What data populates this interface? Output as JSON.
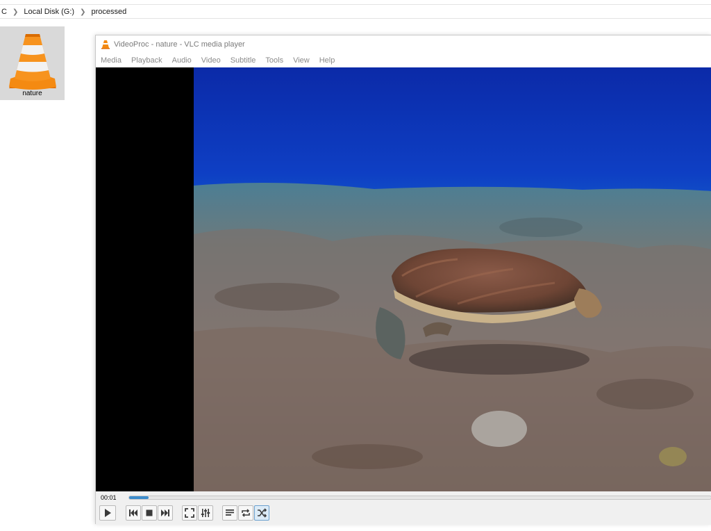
{
  "explorer": {
    "breadcrumb": [
      "C",
      "Local Disk (G:)",
      "processed"
    ]
  },
  "desktop": {
    "icon_label": "nature",
    "icon": "vlc-cone-icon"
  },
  "vlc": {
    "title": "VideoProc - nature - VLC media player",
    "menu": [
      "Media",
      "Playback",
      "Audio",
      "Video",
      "Subtitle",
      "Tools",
      "View",
      "Help"
    ],
    "time_elapsed": "00:01",
    "progress_fraction": 0.034,
    "buttons": [
      {
        "name": "play-button",
        "icon": "play-icon"
      },
      {
        "name": "previous-button",
        "icon": "previous-icon"
      },
      {
        "name": "stop-button",
        "icon": "stop-icon"
      },
      {
        "name": "next-button",
        "icon": "next-icon"
      },
      {
        "name": "fullscreen-button",
        "icon": "fullscreen-icon"
      },
      {
        "name": "extended-settings-button",
        "icon": "equalizer-icon"
      },
      {
        "name": "playlist-button",
        "icon": "playlist-icon"
      },
      {
        "name": "loop-button",
        "icon": "loop-icon"
      },
      {
        "name": "shuffle-button",
        "icon": "shuffle-icon"
      }
    ],
    "shuffle_active": true,
    "accent": "#3c8ccc"
  }
}
